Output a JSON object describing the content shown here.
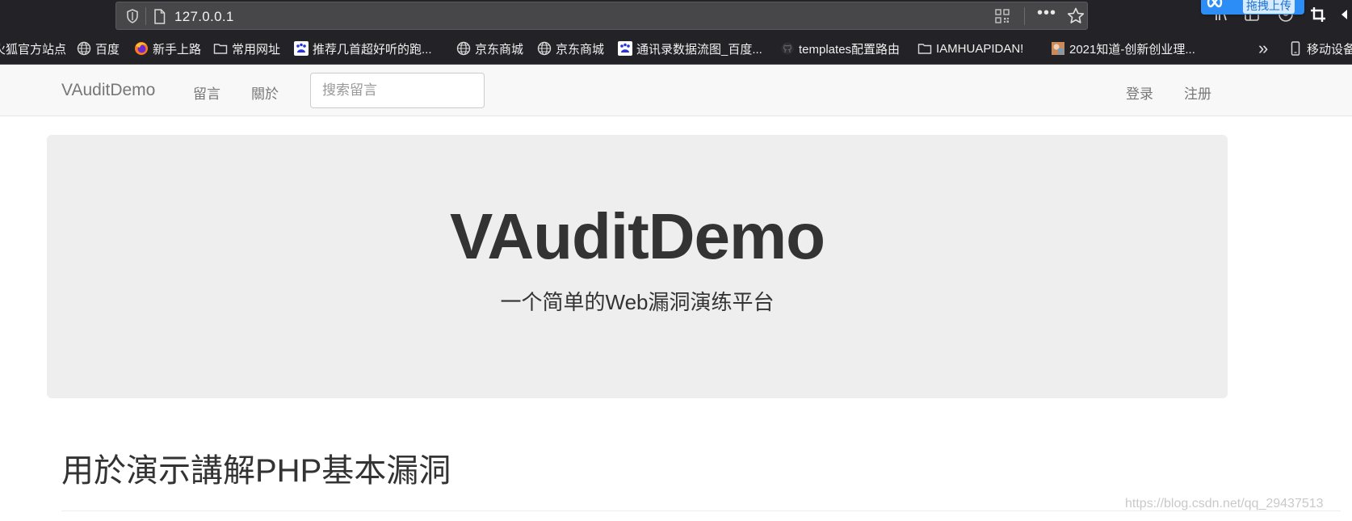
{
  "browser": {
    "url": "127.0.0.1",
    "more_label": "•••",
    "upload_label": "拖拽上传",
    "bookmarks": [
      {
        "label": "火狐官方站点",
        "icon": "firefox-site-icon"
      },
      {
        "label": "百度",
        "icon": "globe-icon"
      },
      {
        "label": "新手上路",
        "icon": "firefox-icon"
      },
      {
        "label": "常用网址",
        "icon": "folder-icon"
      },
      {
        "label": "推荐几首超好听的跑...",
        "icon": "baidu-paw-icon"
      },
      {
        "label": "京东商城",
        "icon": "globe-icon"
      },
      {
        "label": "京东商城",
        "icon": "globe-icon"
      },
      {
        "label": "通讯录数据流图_百度...",
        "icon": "baidu-paw-icon"
      },
      {
        "label": "templates配置路由",
        "icon": "github-icon"
      },
      {
        "label": "IAMHUAPIDAN!",
        "icon": "folder-icon"
      },
      {
        "label": "2021知道-创新创业理...",
        "icon": "thumbnail-icon"
      }
    ],
    "overflow_label": "»",
    "mobile_label": "移动设备"
  },
  "navbar": {
    "brand": "VAuditDemo",
    "links": [
      "留言",
      "關於"
    ],
    "search_placeholder": "搜索留言",
    "right_links": [
      "登录",
      "注册"
    ]
  },
  "jumbotron": {
    "title": "VAuditDemo",
    "subtitle": "一个简单的Web漏洞演练平台"
  },
  "section": {
    "title": "用於演示講解PHP基本漏洞"
  },
  "watermark": "https://blog.csdn.net/qq_29437513",
  "colors": {
    "chrome_bg": "#232327",
    "navbar_bg": "#f8f8f8",
    "jumbotron_bg": "#eeeeee",
    "text": "#333333",
    "nav_text": "#777777"
  }
}
